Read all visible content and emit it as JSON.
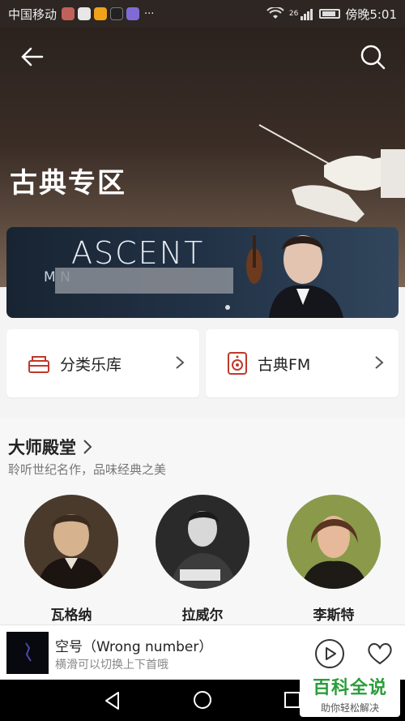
{
  "status_bar": {
    "carrier": "中国移动",
    "dots": "···",
    "network": "26",
    "time": "傍晚5:01"
  },
  "header": {
    "title": "古典专区"
  },
  "banner": {
    "title": "ASCENT",
    "subtitle": "M                    N"
  },
  "entries": [
    {
      "label": "分类乐库",
      "icon": "library-icon"
    },
    {
      "label": "古典FM",
      "icon": "speaker-icon"
    }
  ],
  "section": {
    "title": "大师殿堂",
    "subtitle": "聆听世纪名作，品味经典之美"
  },
  "masters": [
    {
      "name": "瓦格纳"
    },
    {
      "name": "拉威尔"
    },
    {
      "name": "李斯特"
    }
  ],
  "player": {
    "song_title": "空号（Wrong number）",
    "hint": "横滑可以切换上下首哦"
  },
  "watermark": {
    "main": "百科全说",
    "sub": "助你轻松解决"
  },
  "colors": {
    "accent": "#c0392b",
    "hero_dark": "#2b221e",
    "watermark_green": "#2a9d3a"
  }
}
